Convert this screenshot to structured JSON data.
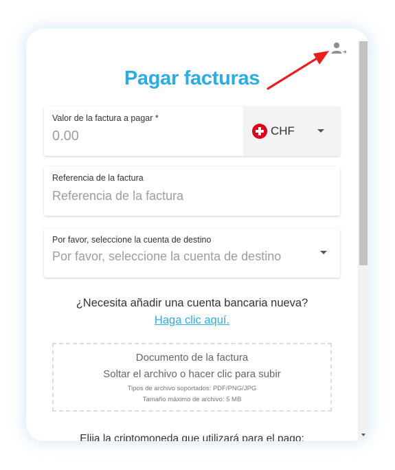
{
  "page": {
    "title": "Pagar facturas"
  },
  "amount_field": {
    "label": "Valor de la factura a pagar *",
    "placeholder": "0.00",
    "currency_code": "CHF",
    "currency_icon": "swiss-flag-icon"
  },
  "reference_field": {
    "label": "Referencia de la factura",
    "placeholder": "Referencia de la factura"
  },
  "account_field": {
    "label": "Por favor, seleccione la cuenta de destino",
    "placeholder": "Por favor, seleccione la cuenta de destino"
  },
  "new_account": {
    "question": "¿Necesita añadir una cuenta bancaria nueva?",
    "link_text": "Haga clic aquí."
  },
  "upload": {
    "title": "Documento de la factura",
    "instruction": "Soltar el archivo o hacer clic para subir",
    "types": "Tipos de archivo soportados: PDF/PNG/JPG",
    "max_size": "Tamaño máximo de archivo: 5 MB"
  },
  "crypto": {
    "heading": "Elija la criptomoneda que utilizará para el pago:"
  },
  "colors": {
    "accent": "#29ade8",
    "annotation_arrow": "#ee1c1c",
    "swiss_red": "#e2001a"
  },
  "icons": {
    "user_switch": "user-switch-icon",
    "dropdown": "caret-down-icon"
  }
}
